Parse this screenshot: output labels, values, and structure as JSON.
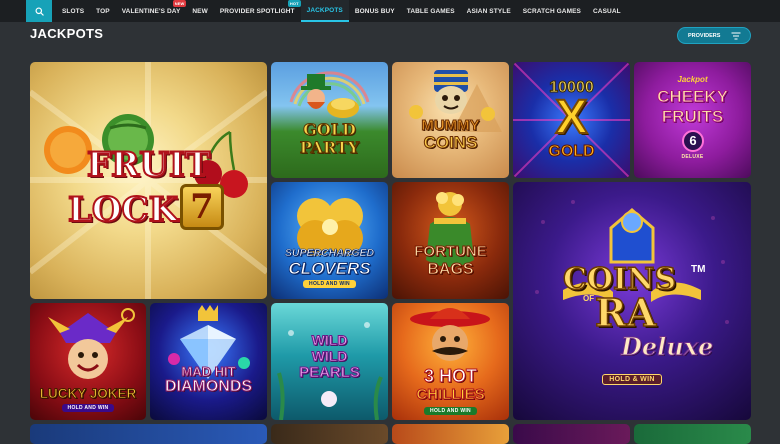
{
  "nav": {
    "search_icon": "search-icon",
    "items": [
      {
        "label": "SLOTS"
      },
      {
        "label": "TOP"
      },
      {
        "label": "VALENTINE'S DAY",
        "badge": "NEW"
      },
      {
        "label": "NEW"
      },
      {
        "label": "PROVIDER SPOTLIGHT",
        "badge": "HOT"
      },
      {
        "label": "JACKPOTS",
        "active": true
      },
      {
        "label": "BONUS BUY"
      },
      {
        "label": "TABLE GAMES"
      },
      {
        "label": "ASIAN STYLE"
      },
      {
        "label": "SCRATCH GAMES"
      },
      {
        "label": "CASUAL"
      }
    ]
  },
  "section": {
    "title": "JACKPOTS",
    "providers_label": "PROVIDERS",
    "filter_icon": "filter-icon"
  },
  "games": {
    "fruit_lock": {
      "line1": "FRUIT",
      "line2": "LOCK",
      "num": "7"
    },
    "gold_party": {
      "line1": "GOLD",
      "line2": "PARTY"
    },
    "mummy_coins": {
      "line1": "MUMMY",
      "line2": "COINS"
    },
    "ten_thousand_x_gold": {
      "line1": "10000",
      "line2": "X",
      "line3": "GOLD"
    },
    "cheeky_fruits": {
      "pre": "Jackpot",
      "line1": "CHEEKY",
      "line2": "FRUITS",
      "num": "6",
      "sub": "DELUXE"
    },
    "supercharged_clovers": {
      "line1": "SUPERCHARGED",
      "line2": "CLOVERS",
      "sub": "HOLD AND WIN"
    },
    "fortune_bags": {
      "line1": "FORTUNE",
      "line2": "BAGS"
    },
    "coins_of_ra": {
      "line1": "COINS",
      "of": "OF",
      "line2": "RA",
      "tm": "TM",
      "line3": "Deluxe",
      "sub": "HOLD & WIN"
    },
    "lucky_joker": {
      "line1": "LUCKY JOKER",
      "sub": "HOLD AND WIN"
    },
    "mad_hit_diamonds": {
      "line1": "MAD HIT",
      "line2": "DIAMONDS"
    },
    "wild_wild_pearls": {
      "line1": "WILD",
      "line2": "WILD",
      "line3": "PEARLS"
    },
    "three_hot_chillies": {
      "line1": "3 HOT",
      "line2": "CHILLIES",
      "sub": "HOLD AND WIN"
    }
  },
  "colors": {
    "accent": "#17a2b8",
    "active_tab": "#29c5e6",
    "background": "#2e3236",
    "nav_bg": "#1c1f22"
  }
}
